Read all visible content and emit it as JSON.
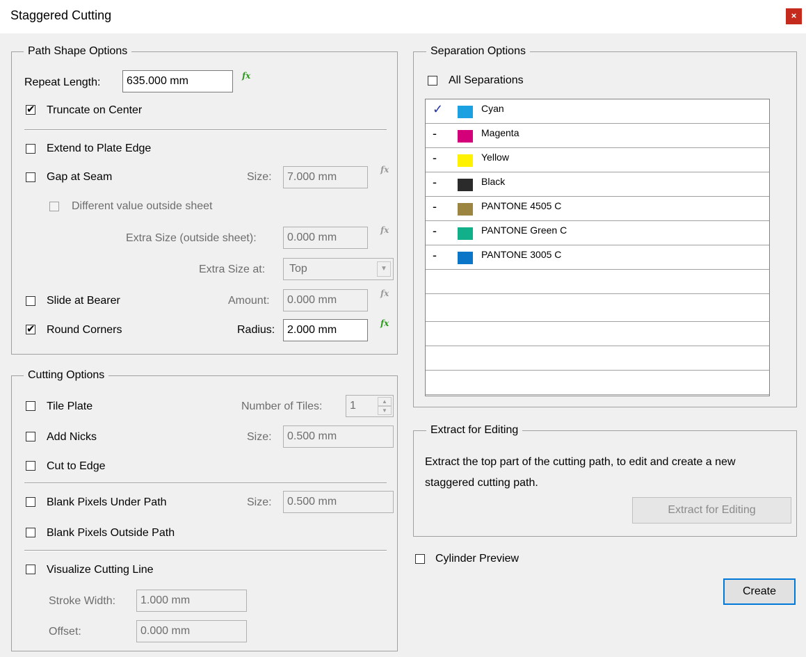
{
  "window": {
    "title": "Staggered Cutting",
    "close": "×"
  },
  "path_shape": {
    "legend": "Path Shape Options",
    "repeat_length_label": "Repeat Length:",
    "repeat_length_value": "635.000 mm",
    "truncate_label": "Truncate on Center",
    "extend_label": "Extend to Plate Edge",
    "gap_label": "Gap at Seam",
    "gap_size_label": "Size:",
    "gap_size_value": "7.000 mm",
    "different_label": "Different value outside sheet",
    "extra_size_label": "Extra Size (outside sheet):",
    "extra_size_value": "0.000 mm",
    "extra_at_label": "Extra Size at:",
    "extra_at_value": "Top",
    "slide_label": "Slide at Bearer",
    "amount_label": "Amount:",
    "amount_value": "0.000 mm",
    "round_label": "Round Corners",
    "radius_label": "Radius:",
    "radius_value": "2.000 mm",
    "fx": "fx"
  },
  "cutting": {
    "legend": "Cutting Options",
    "tile_label": "Tile Plate",
    "tiles_label": "Number of Tiles:",
    "tiles_value": "1",
    "nicks_label": "Add Nicks",
    "nicks_size_label": "Size:",
    "nicks_size_value": "0.500 mm",
    "cut_edge_label": "Cut to Edge",
    "blank_under_label": "Blank Pixels Under Path",
    "blank_size_label": "Size:",
    "blank_size_value": "0.500 mm",
    "blank_outside_label": "Blank Pixels Outside Path",
    "visualize_label": "Visualize Cutting Line",
    "stroke_label": "Stroke Width:",
    "stroke_value": "1.000 mm",
    "offset_label": "Offset:",
    "offset_value": "0.000 mm"
  },
  "separation": {
    "legend": "Separation Options",
    "all_label": "All Separations",
    "rows": [
      {
        "mark": "✓",
        "name": "Cyan",
        "color": "#1ba1e2"
      },
      {
        "mark": "-",
        "name": "Magenta",
        "color": "#d4007a"
      },
      {
        "mark": "-",
        "name": "Yellow",
        "color": "#fff200"
      },
      {
        "mark": "-",
        "name": "Black",
        "color": "#2b2b2b"
      },
      {
        "mark": "-",
        "name": "PANTONE 4505 C",
        "color": "#9c8540"
      },
      {
        "mark": "-",
        "name": "PANTONE Green C",
        "color": "#12b08a"
      },
      {
        "mark": "-",
        "name": "PANTONE 3005 C",
        "color": "#0b76c8"
      }
    ]
  },
  "extract": {
    "legend": "Extract for Editing",
    "description": "Extract the top part of the cutting path, to edit and create a new staggered cutting path.",
    "button": "Extract for Editing"
  },
  "cylinder_label": "Cylinder Preview",
  "create_button": "Create"
}
